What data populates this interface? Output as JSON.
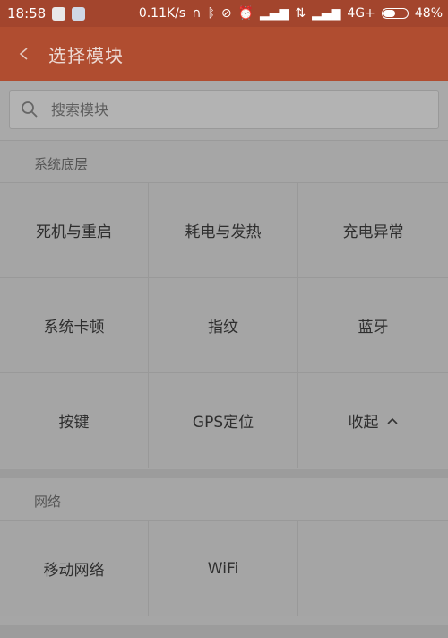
{
  "status_bar": {
    "time": "18:58",
    "network_speed": "0.11K/s",
    "network_type": "4G+",
    "battery": "48%",
    "battery_level": 0.48
  },
  "header": {
    "title": "选择模块"
  },
  "search": {
    "placeholder": "搜索模块"
  },
  "sections": [
    {
      "title": "系统底层",
      "items": [
        "死机与重启",
        "耗电与发热",
        "充电异常",
        "系统卡顿",
        "指纹",
        "蓝牙",
        "按键",
        "GPS定位",
        "收起"
      ]
    },
    {
      "title": "网络",
      "items": [
        "移动网络",
        "WiFi",
        ""
      ]
    }
  ],
  "colors": {
    "header_bg": "#b04d30",
    "status_bg": "#a3452d",
    "page_bg": "#a6a6a6"
  },
  "icons": {
    "back": "chevron-left-icon",
    "search": "search-icon",
    "collapse": "chevron-up-icon"
  }
}
